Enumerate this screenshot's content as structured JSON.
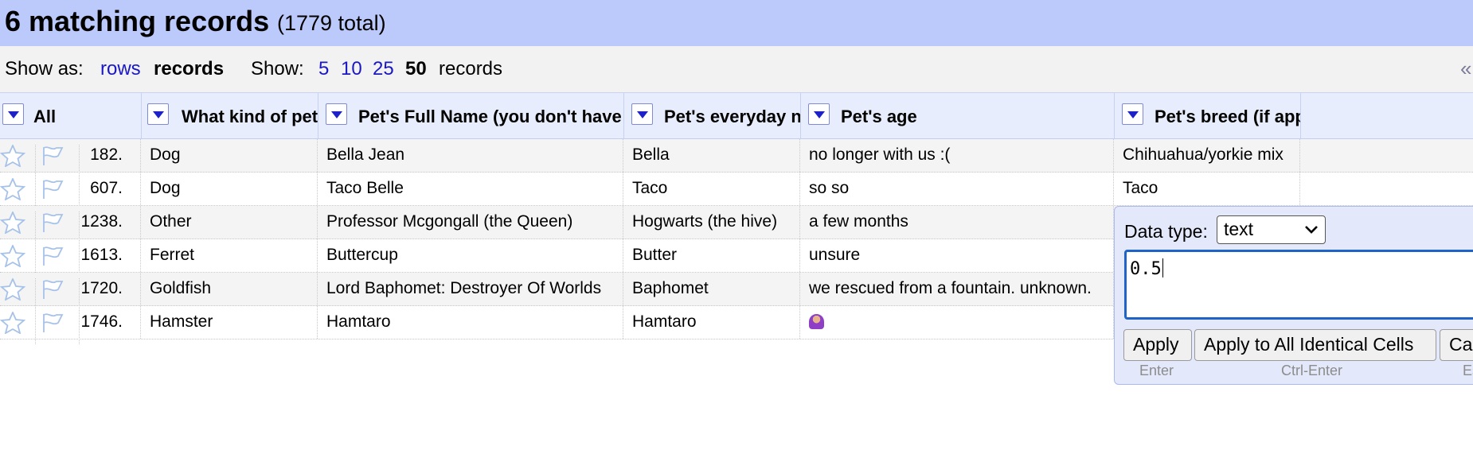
{
  "summary": {
    "matching": "6 matching records",
    "total": "(1779 total)"
  },
  "toolbar": {
    "show_as_label": "Show as:",
    "rows_link": "rows",
    "records_label": "records",
    "show_label": "Show:",
    "page_sizes": [
      "5",
      "10",
      "25",
      "50"
    ],
    "current_size": "50",
    "records_suffix": "records",
    "collapse_glyph": "«"
  },
  "columns": {
    "all": "All",
    "kind": "What kind of pet",
    "full_name": "Pet's Full Name (you don't have",
    "everyday": "Pet's everyday n",
    "age": "Pet's age",
    "breed": "Pet's breed (if app"
  },
  "rows": [
    {
      "id": "182.",
      "kind": "Dog",
      "full_name": "Bella Jean",
      "everyday": "Bella",
      "age": "no longer with us :(",
      "breed": "Chihuahua/yorkie mix"
    },
    {
      "id": "607.",
      "kind": "Dog",
      "full_name": "Taco Belle",
      "everyday": "Taco",
      "age": "so so",
      "breed": "Taco"
    },
    {
      "id": "1238.",
      "kind": "Other",
      "full_name": "Professor Mcgongall (the Queen)",
      "everyday": "Hogwarts (the hive)",
      "age": "a few months",
      "breed": ""
    },
    {
      "id": "1613.",
      "kind": "Ferret",
      "full_name": "Buttercup",
      "everyday": "Butter",
      "age": "unsure",
      "breed": ""
    },
    {
      "id": "1720.",
      "kind": "Goldfish",
      "full_name": "Lord Baphomet: Destroyer Of Worlds",
      "everyday": "Baphomet",
      "age": "we rescued from a fountain. unknown.",
      "breed": ""
    },
    {
      "id": "1746.",
      "kind": "Hamster",
      "full_name": "Hamtaro",
      "everyday": "Hamtaro",
      "age": "",
      "breed": ""
    }
  ],
  "icons": {
    "row_star": "star-outline-icon",
    "row_flag": "flag-outline-icon",
    "column_menu": "dropdown-triangle-icon",
    "age_emoji": "woman-shrugging-emoji-icon"
  },
  "editor": {
    "data_type_label": "Data type:",
    "data_type_value": "text",
    "value": "0.5",
    "apply_label": "Apply",
    "apply_all_label": "Apply to All Identical Cells",
    "cancel_label": "Cancel",
    "apply_hint": "Enter",
    "apply_all_hint": "Ctrl-Enter",
    "cancel_hint": "Esc"
  },
  "colors": {
    "header_bg": "#bcc9fb",
    "toolbar_bg": "#f2f2f2",
    "column_header_bg": "#e7edfc",
    "link": "#1a18c4",
    "editor_bg": "#e3e9fb",
    "editor_focus": "#1e64c8"
  }
}
